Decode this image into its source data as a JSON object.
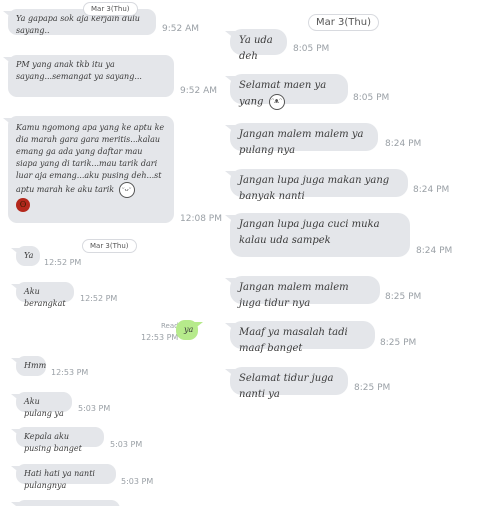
{
  "left": {
    "date_top": "Mar 3(Thu)",
    "date_mid": "Mar 3(Thu)",
    "messages": [
      {
        "text": "Ya gapapa sok aja kerjain dulu sayang..",
        "time": "9:52 AM"
      },
      {
        "text": "PM yang anak tkb itu ya sayang...semangat ya sayang...",
        "time": "9:52 AM"
      },
      {
        "text": "Kamu ngomong apa yang ke aptu ke dia marah gara gara meritis...kalau emang ga ada yang daftar mau siapa yang di tarik...mau tarik dari luar aja emang...aku pusing deh...st aptu marah ke aku tarik",
        "time": "12:08 PM"
      },
      {
        "text": "Ya",
        "time": "12:52 PM"
      },
      {
        "text": "Aku berangkat",
        "time": "12:52 PM"
      },
      {
        "text": "ya",
        "time": "12:53 PM",
        "status": "Read"
      },
      {
        "text": "Hmm",
        "time": "12:53 PM"
      },
      {
        "text": "Aku pulang ya",
        "time": "5:03 PM"
      },
      {
        "text": "Kepala aku pusing banget",
        "time": "5:03 PM"
      },
      {
        "text": "Hati hati ya nanti pulangnya",
        "time": "5:03 PM"
      }
    ],
    "emoji": {
      "smile": "smile-face-icon",
      "angry": "angry-face-icon"
    }
  },
  "right": {
    "date": "Mar 3(Thu)",
    "messages": [
      {
        "text": "Ya uda deh",
        "time": "8:05 PM"
      },
      {
        "text": "Selamat maen ya yang",
        "time": "8:05 PM"
      },
      {
        "text": "Jangan malem malem ya pulang nya",
        "time": "8:24 PM"
      },
      {
        "text": "Jangan lupa juga makan yang banyak nanti",
        "time": "8:24 PM"
      },
      {
        "text": "Jangan lupa juga cuci muka kalau uda sampek",
        "time": "8:24 PM"
      },
      {
        "text": "Jangan malem malem juga tidur nya",
        "time": "8:25 PM"
      },
      {
        "text": "Maaf ya masalah tadi maaf banget",
        "time": "8:25 PM"
      },
      {
        "text": "Selamat tidur juga nanti ya",
        "time": "8:25 PM"
      }
    ],
    "emoji": {
      "laugh": "laughing-face-icon"
    }
  }
}
